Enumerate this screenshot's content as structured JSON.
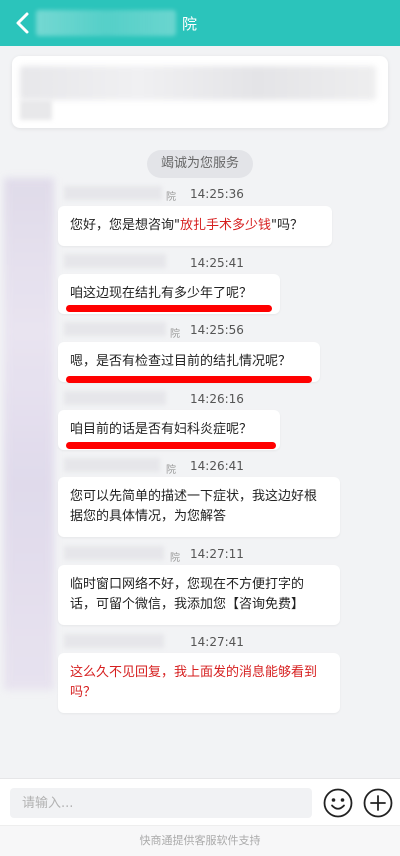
{
  "header": {
    "title_suffix": "院",
    "back_icon": "chevron-left-icon"
  },
  "service_pill": "竭诚为您服务",
  "messages": [
    {
      "sender_suffix": "院",
      "time": "14:25:36",
      "pre": "您好，您是想咨询\"",
      "highlight": "放扎手术多少钱",
      "post": "\"吗？"
    },
    {
      "sender_suffix": "",
      "time": "14:25:41",
      "text": "咱这边现在结扎有多少年了呢？"
    },
    {
      "sender_suffix": "院",
      "time": "14:25:56",
      "text": "嗯，是否有检查过目前的结扎情况呢？"
    },
    {
      "sender_suffix": "",
      "time": "14:26:16",
      "text": "咱目前的话是否有妇科炎症呢？"
    },
    {
      "sender_suffix": "院",
      "time": "14:26:41",
      "text": "您可以先简单的描述一下症状，我这边好根据您的具体情况，为您解答"
    },
    {
      "sender_suffix": "院",
      "time": "14:27:11",
      "text": "临时窗口网络不好，您现在不方便打字的话，可留个微信，我添加您【咨询免费】"
    },
    {
      "sender_suffix": "",
      "time": "14:27:41",
      "text": "这么久不见回复，我上面发的消息能够看到吗？"
    }
  ],
  "footer": {
    "input_placeholder": "请输入...",
    "emoji_icon": "smiley-icon",
    "plus_icon": "plus-circle-icon",
    "support_text": "快商通提供客服软件支持"
  },
  "colors": {
    "header": "#2bc4bb",
    "highlight": "#d61f1f",
    "underline": "#ff0000"
  }
}
